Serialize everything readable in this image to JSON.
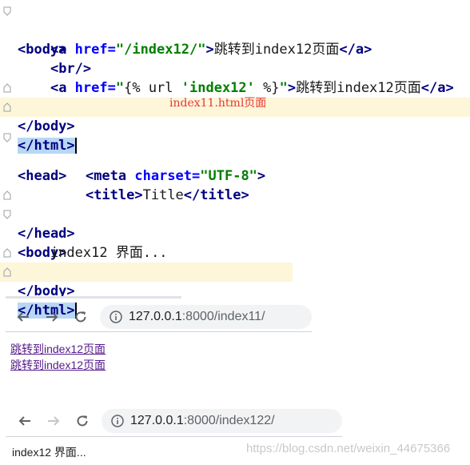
{
  "editor1": {
    "l1_tag": "<body>",
    "l2_a1": "<a ",
    "l2_attr": "href=",
    "l2_str": "\"/index12/\"",
    "l2_gt": ">",
    "l2_text": "跳转到index12页面",
    "l2_close": "</a>",
    "l3_tag": "<br/>",
    "l4_a1": "<a ",
    "l4_attr": "href=",
    "l4_q1": "\"",
    "l4_tpl1": "{% url ",
    "l4_str": "'index12'",
    "l4_tpl2": " %}",
    "l4_q2": "\"",
    "l4_gt": ">",
    "l4_text": "跳转到index12页面",
    "l4_close": "</a>",
    "l5_tag": "</body>",
    "l6_tag": "</html>",
    "note": "index11.html页面"
  },
  "editor2": {
    "l1_tag": "<head>",
    "l2_tag_open": "<meta ",
    "l2_attr": "charset=",
    "l2_str": "\"UTF-8\"",
    "l2_gt": ">",
    "l3_open": "<title>",
    "l3_text": "Title",
    "l3_close": "</title>",
    "l4_tag": "</head>",
    "l5_tag": "<body>",
    "l6_text": "index12 界面...",
    "l7_tag": "</body>",
    "l8_tag": "</html>"
  },
  "browser1": {
    "url_host": "127.0.0.1",
    "url_path": ":8000/index11/",
    "links": [
      "跳转到index12页面",
      "跳转到index12页面"
    ]
  },
  "browser2": {
    "url_host": "127.0.0.1",
    "url_path": ":8000/index122/",
    "page_text": "index12 界面..."
  },
  "watermark": "https://blog.csdn.net/weixin_44675366",
  "colors": {
    "tag": "#000080",
    "attr": "#0000ff",
    "string": "#008000",
    "note": "#e53935",
    "link": "#551a8b",
    "highlight": "#fdf6d9",
    "selection": "#b8d7f5"
  },
  "icons": [
    "fold-marker-icon",
    "back-arrow-icon",
    "forward-arrow-icon",
    "reload-icon",
    "info-icon"
  ]
}
